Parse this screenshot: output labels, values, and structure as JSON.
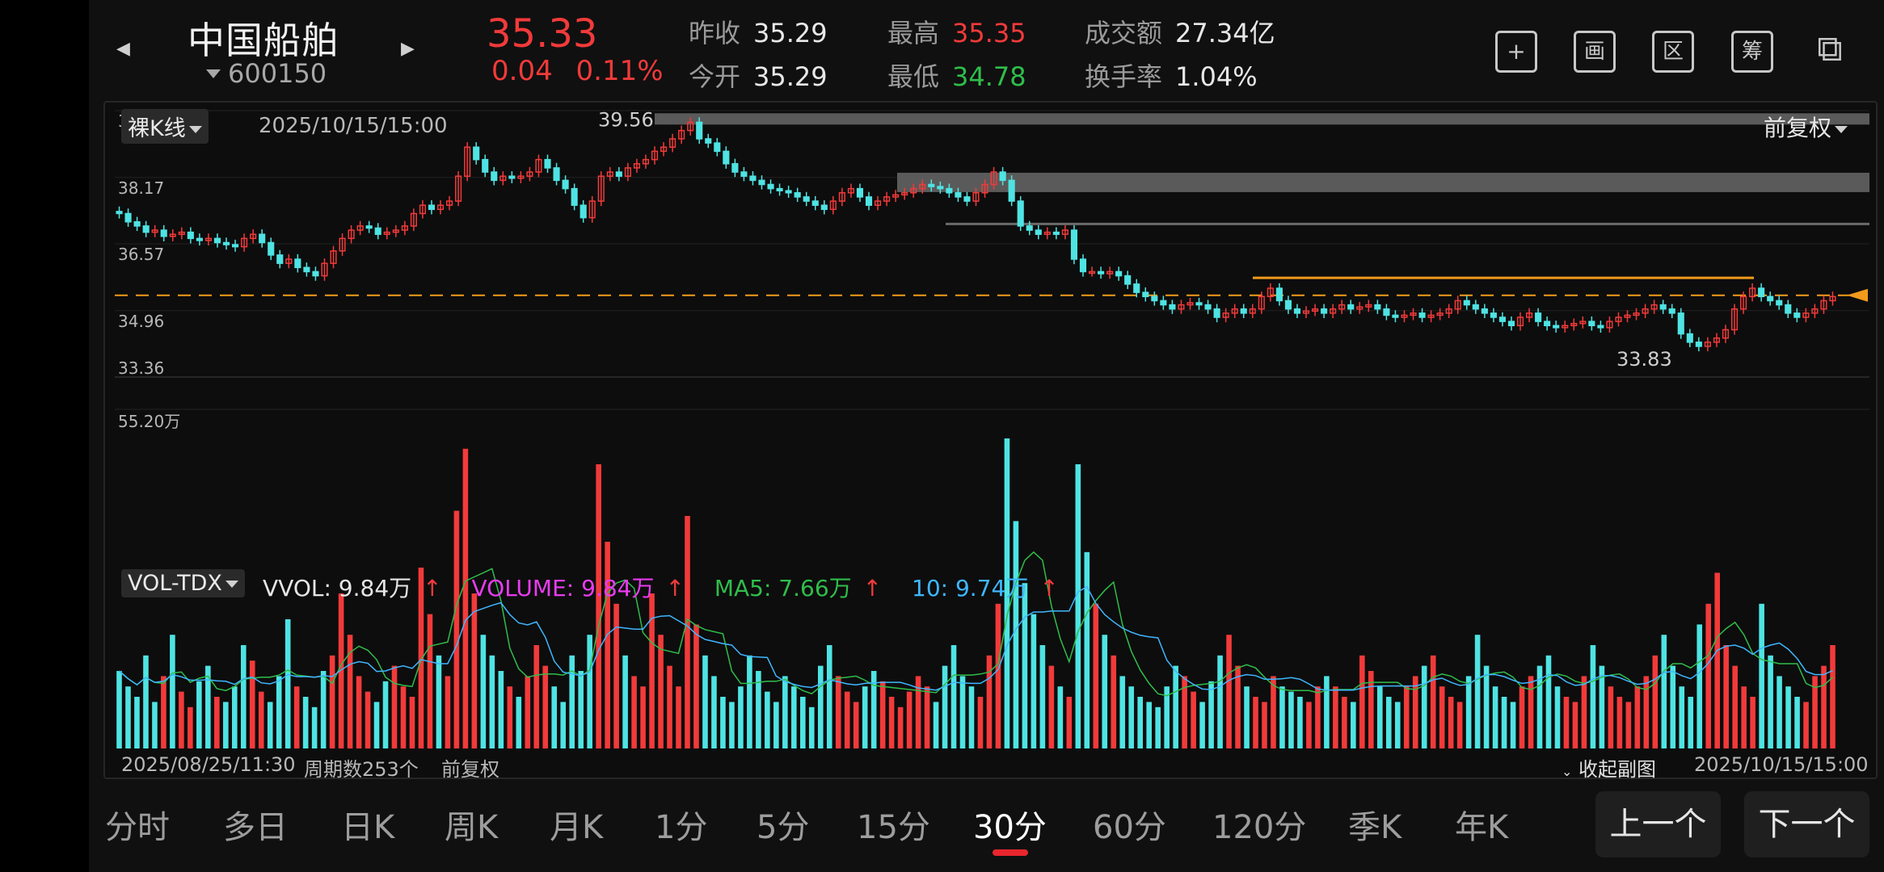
{
  "header": {
    "stock_name": "中国船舶",
    "stock_code": "600150",
    "price": "35.33",
    "change": "0.04",
    "change_pct": "0.11%",
    "prev_close_label": "昨收",
    "prev_close": "35.29",
    "open_label": "今开",
    "open": "35.29",
    "high_label": "最高",
    "high": "35.35",
    "low_label": "最低",
    "low": "34.78",
    "turnover_label": "成交额",
    "turnover": "27.34亿",
    "turnover_rate_label": "换手率",
    "turnover_rate": "1.04%",
    "tools": [
      {
        "icon": "plus-icon",
        "glyph": "+"
      },
      {
        "icon": "draw-icon",
        "glyph": "画"
      },
      {
        "icon": "range-icon",
        "glyph": "区"
      },
      {
        "icon": "chips-icon",
        "glyph": "筹"
      },
      {
        "icon": "landscape-switch-icon",
        "glyph": "⧉"
      }
    ]
  },
  "chart_header": {
    "kline_mode": "裸K线",
    "datetime": "2025/10/15/15:00",
    "adjust": "前复权"
  },
  "indicator": {
    "name": "VOL-TDX",
    "vvol": "VVOL: 9.84万",
    "volume": "VOLUME: 9.84万",
    "ma5": "MA5: 7.66万",
    "ma10": "10: 9.74万",
    "max_label": "55.20万"
  },
  "footer_info": {
    "start": "2025/08/25/11:30",
    "periods": "周期数253个",
    "adjust": "前复权",
    "collapse": "收起副图",
    "end": "2025/10/15/15:00"
  },
  "chart_data": {
    "type": "candlestick",
    "y_ticks": [
      "39.78",
      "38.17",
      "36.57",
      "34.96",
      "33.36"
    ],
    "ylim": [
      33.36,
      39.78
    ],
    "annotations": {
      "high_label": "39.56",
      "low_label": "33.83",
      "reference_price": 35.33
    },
    "close_series": [
      37.3,
      37.1,
      37.0,
      36.85,
      36.9,
      36.75,
      36.8,
      36.85,
      36.7,
      36.65,
      36.7,
      36.6,
      36.55,
      36.5,
      36.7,
      36.8,
      36.6,
      36.3,
      36.1,
      36.2,
      36.0,
      35.9,
      35.8,
      36.1,
      36.4,
      36.7,
      36.9,
      37.0,
      36.95,
      36.8,
      36.85,
      36.9,
      37.0,
      37.3,
      37.5,
      37.4,
      37.5,
      37.6,
      38.2,
      38.9,
      38.6,
      38.3,
      38.1,
      38.2,
      38.15,
      38.2,
      38.3,
      38.6,
      38.4,
      38.1,
      37.9,
      37.5,
      37.2,
      37.6,
      38.2,
      38.3,
      38.2,
      38.4,
      38.5,
      38.6,
      38.8,
      38.9,
      39.1,
      39.3,
      39.5,
      39.1,
      39.0,
      38.8,
      38.5,
      38.3,
      38.2,
      38.1,
      38.0,
      37.9,
      37.85,
      37.8,
      37.7,
      37.6,
      37.5,
      37.4,
      37.6,
      37.8,
      37.9,
      37.7,
      37.5,
      37.6,
      37.7,
      37.75,
      37.8,
      37.9,
      38.0,
      37.95,
      37.9,
      37.8,
      37.7,
      37.6,
      37.8,
      38.0,
      38.3,
      38.1,
      37.6,
      37.0,
      36.9,
      36.8,
      36.85,
      36.8,
      36.9,
      36.2,
      35.9,
      35.9,
      35.85,
      35.9,
      35.8,
      35.6,
      35.4,
      35.3,
      35.2,
      35.1,
      35.0,
      35.1,
      35.15,
      35.1,
      35.0,
      34.8,
      34.9,
      35.0,
      34.9,
      35.0,
      35.3,
      35.5,
      35.2,
      35.0,
      34.9,
      34.95,
      35.0,
      34.9,
      35.0,
      35.1,
      35.0,
      35.05,
      35.1,
      35.0,
      34.85,
      34.8,
      34.85,
      34.9,
      34.8,
      34.85,
      34.9,
      35.0,
      35.2,
      35.1,
      35.0,
      34.9,
      34.8,
      34.7,
      34.6,
      34.8,
      34.9,
      34.7,
      34.6,
      34.55,
      34.6,
      34.65,
      34.7,
      34.6,
      34.55,
      34.7,
      34.8,
      34.85,
      34.9,
      35.0,
      35.1,
      35.0,
      34.9,
      34.4,
      34.2,
      34.1,
      34.2,
      34.3,
      34.5,
      35.0,
      35.3,
      35.5,
      35.3,
      35.2,
      35.1,
      34.9,
      34.8,
      34.9,
      35.0,
      35.2,
      35.3
    ],
    "volume_series": [
      15,
      12,
      10,
      18,
      9,
      14,
      22,
      11,
      8,
      13,
      16,
      10,
      9,
      12,
      20,
      17,
      11,
      9,
      14,
      25,
      12,
      10,
      8,
      15,
      18,
      30,
      22,
      14,
      11,
      9,
      13,
      16,
      12,
      10,
      35,
      26,
      18,
      14,
      46,
      58,
      30,
      22,
      18,
      15,
      12,
      10,
      14,
      20,
      16,
      12,
      9,
      18,
      15,
      22,
      55,
      40,
      28,
      18,
      14,
      12,
      30,
      22,
      16,
      12,
      45,
      24,
      18,
      14,
      10,
      9,
      12,
      18,
      15,
      11,
      9,
      14,
      12,
      10,
      8,
      16,
      20,
      14,
      11,
      9,
      12,
      15,
      13,
      10,
      8,
      11,
      14,
      12,
      9,
      16,
      20,
      14,
      12,
      10,
      18,
      28,
      60,
      44,
      32,
      26,
      20,
      16,
      12,
      10,
      55,
      38,
      28,
      22,
      18,
      14,
      12,
      10,
      9,
      8,
      12,
      16,
      14,
      11,
      9,
      13,
      18,
      22,
      16,
      12,
      10,
      9,
      14,
      12,
      11,
      10,
      9,
      12,
      14,
      12,
      10,
      9,
      18,
      15,
      12,
      10,
      9,
      12,
      14,
      16,
      18,
      12,
      10,
      9,
      14,
      22,
      16,
      12,
      10,
      9,
      12,
      14,
      16,
      18,
      12,
      10,
      9,
      14,
      20,
      16,
      12,
      10,
      9,
      12,
      14,
      18,
      22,
      16,
      12,
      10,
      24,
      28,
      34,
      20,
      16,
      12,
      10,
      28,
      18,
      14,
      12,
      10,
      9,
      14,
      16,
      20
    ]
  },
  "bottom_bar": {
    "tabs": [
      "分时",
      "多日",
      "日K",
      "周K",
      "月K",
      "1分",
      "5分",
      "15分",
      "30分",
      "60分",
      "120分",
      "季K",
      "年K"
    ],
    "active": "30分",
    "prev": "上一个",
    "next": "下一个"
  },
  "colors": {
    "up": "#f23a3a",
    "down": "#4fe3e3",
    "accent": "#f29b1b",
    "ma5": "#2fbe4a",
    "ma10": "#3fb7ff"
  }
}
